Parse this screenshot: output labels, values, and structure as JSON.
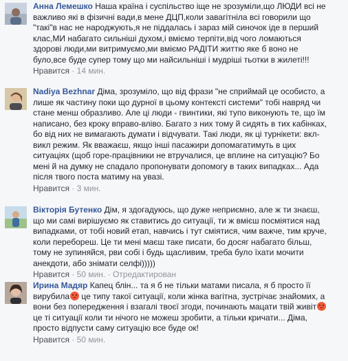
{
  "comments": [
    {
      "author": "Анна Лемешко",
      "lines": [
        "Наша країна і суспільство іще не зрозуміли,що ЛЮДИ всі не",
        "важливо які в фізичні вади,в мене ДЦП,коли завагітніла всі говорили що",
        "\"такі\"в нас не народжують,я не піддалась і зараз мій синочок іде в перший",
        "клас,МИ набагато сильніші духом,і вміємо терпіти,від чого ломаються",
        "здорові люди,ми витримуємо,ми вміємо РАДІТИ життю яке б воно не",
        "було,все буде супер тому що ми найсильніші і мудріші тьотки в жилеті!!!"
      ],
      "like_label": "Нравится",
      "time": "14 мин."
    },
    {
      "author": "Nadiya Bezhnar",
      "lines": [
        "Діма, зрозуміло, що від фрази \"не сприймай це особисто, а",
        "лише як частину поки що дурної в цьому контексті системи\" тобі навряд чи",
        "стане менш образливо. Але ці люди - гвинтики, які тупо виконують те, що їм",
        "написано, без кроку вправо-вліво. Багато з них тому й сидять в тих кабінках,",
        "бо від них не вимагають думати і відчувати. Такі люди, як ці турнікети: вкл-",
        "викл режим. Як вважаєш, якщо інші пасажири допомагатимуть в цих",
        "ситуаціях (щоб горе-працівники не втручалися, це вплине на ситуацію? Бо",
        "мені й на думку не спадало пропонувати допомогу в таких випадках... Ада",
        "після твого поста матиму на увазі."
      ],
      "like_label": "Нравится",
      "time": "3 мин."
    },
    {
      "author": "Вікторія Бутенко",
      "lines": [
        "Дім, я здогадуюсь, що дуже неприємно, але ж ти знаєш,",
        "що ми самі вирішуємо як ставитись до ситуації, ти ж вмієш посміятися над",
        "випадками, от тобі новий етап, навчись і тут сміятися, чим важче, тим круче,",
        "коли перебореш. Це ти мені маєш таке писати, бо досяг набагато більш,",
        "тому не зупиняйся, рви собі і будь щасливим, треба було їхати мочити",
        "анекдоти, або знімати селфі)))))"
      ],
      "like_label": "Нравится",
      "time": "50 мин.",
      "translate_label": "Отредактирован"
    },
    {
      "author": "Ирина Мадяр",
      "lines": [
        "Капец блін... та я б не тільки матами писала, я б просто її",
        "вирубила|EMOJI| це типу такої ситуації, коли жінка вагітна, зустрічає знайомих, а",
        "вони без попередження і взагалі твоєї згоди, починають мацати твій живіт|EMOJI|",
        "це ті ситуації коли ти нічого не можеш зробити, а тільки кричати... Діма,",
        "просто відпусти саму ситуацію все буде ок!"
      ],
      "like_label": "Нравится",
      "time": "50 мин."
    }
  ],
  "colors": {
    "author": "#365899",
    "meta": "#90949c",
    "background": "#f6f7f9"
  },
  "icons": {
    "emoji": "angry-face-icon"
  }
}
